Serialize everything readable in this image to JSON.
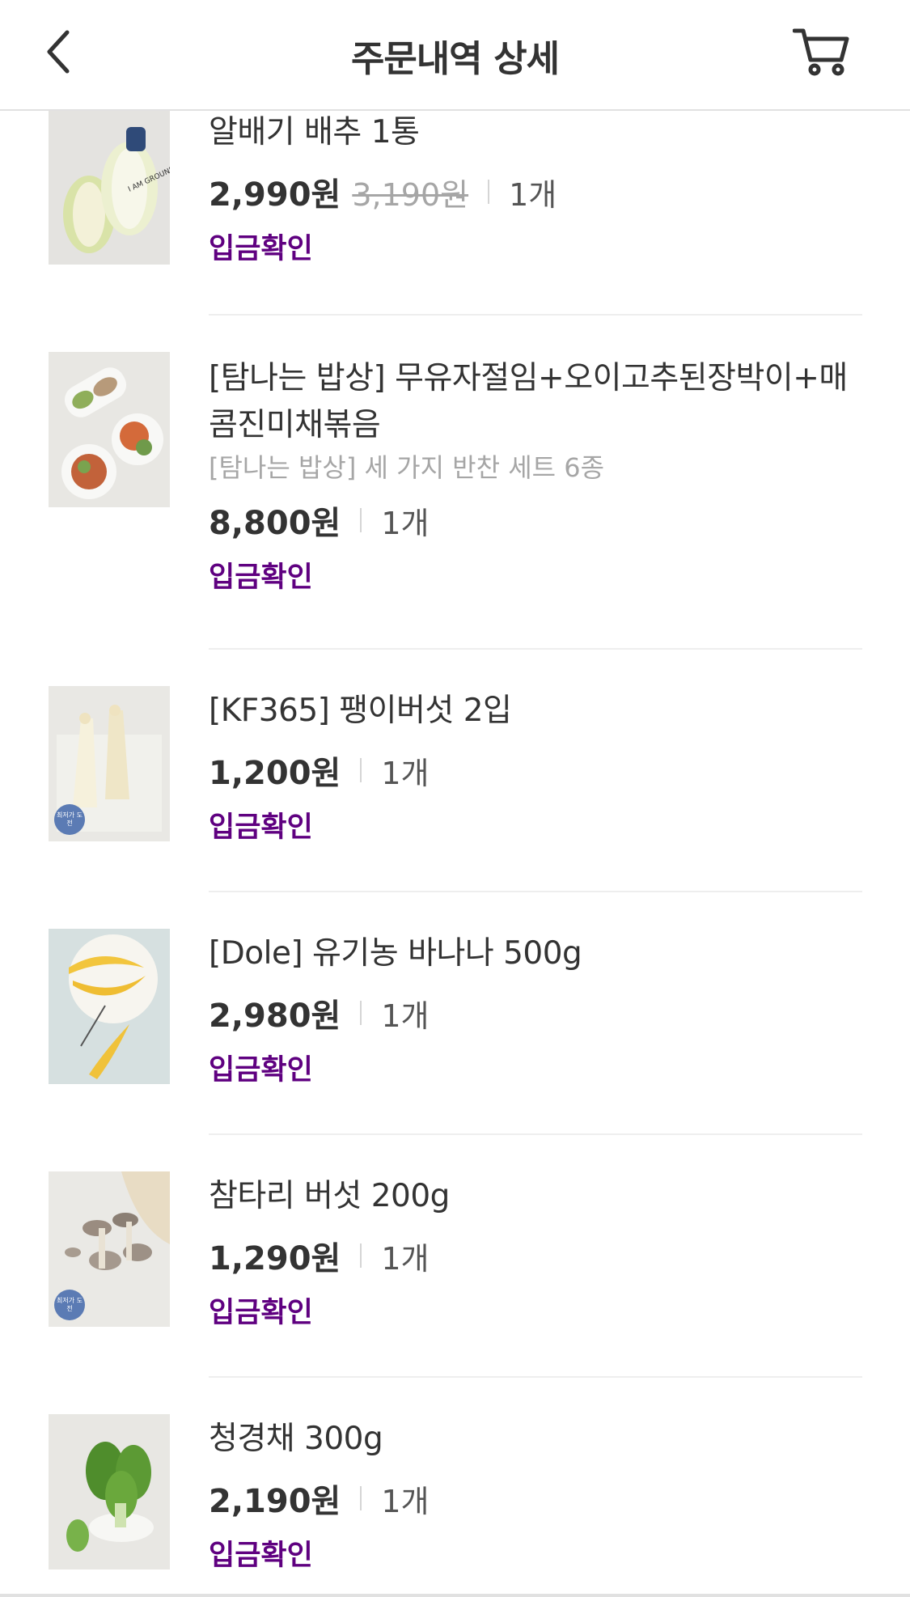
{
  "header": {
    "title": "주문내역 상세",
    "back_icon": "chevron-left-icon",
    "cart_icon": "cart-icon"
  },
  "colors": {
    "accent": "#5f0080",
    "text": "#333333",
    "muted": "#a6a6a6"
  },
  "items": [
    {
      "name": "알배기 배추 1통",
      "option": "",
      "price": "2,990원",
      "original_price": "3,190원",
      "qty": "1개",
      "status": "입금확인",
      "badge": ""
    },
    {
      "name": "[탐나는 밥상] 무유자절임+오이고추된장박이+매콤진미채볶음",
      "option": "[탐나는 밥상] 세 가지 반찬 세트 6종",
      "price": "8,800원",
      "original_price": "",
      "qty": "1개",
      "status": "입금확인",
      "badge": ""
    },
    {
      "name": "[KF365] 팽이버섯 2입",
      "option": "",
      "price": "1,200원",
      "original_price": "",
      "qty": "1개",
      "status": "입금확인",
      "badge": "최저가 도전"
    },
    {
      "name": "[Dole] 유기농 바나나 500g",
      "option": "",
      "price": "2,980원",
      "original_price": "",
      "qty": "1개",
      "status": "입금확인",
      "badge": ""
    },
    {
      "name": "참타리 버섯 200g",
      "option": "",
      "price": "1,290원",
      "original_price": "",
      "qty": "1개",
      "status": "입금확인",
      "badge": "최저가 도전"
    },
    {
      "name": "청경채 300g",
      "option": "",
      "price": "2,190원",
      "original_price": "",
      "qty": "1개",
      "status": "입금확인",
      "badge": ""
    }
  ]
}
